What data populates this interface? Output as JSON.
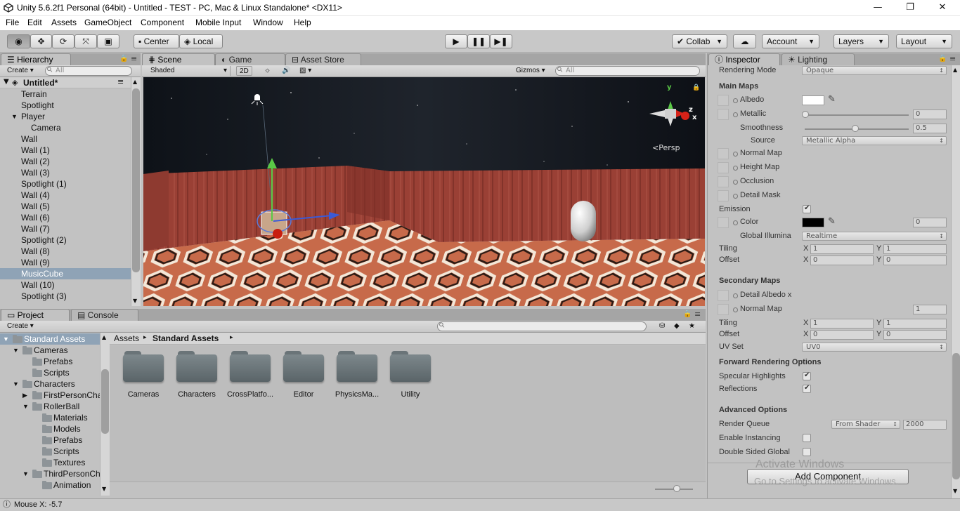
{
  "window": {
    "title": "Unity 5.6.2f1 Personal (64bit) - Untitled - TEST - PC, Mac & Linux Standalone* <DX11>",
    "minimize": "—",
    "restore": "❐",
    "close": "✕"
  },
  "menu": [
    "File",
    "Edit",
    "Assets",
    "GameObject",
    "Component",
    "Mobile Input",
    "Window",
    "Help"
  ],
  "toolbar": {
    "pivot": "Center",
    "space": "Local",
    "collab": "Collab",
    "account": "Account",
    "layers": "Layers",
    "layout": "Layout"
  },
  "hierarchy": {
    "tab": "Hierarchy",
    "create": "Create",
    "search_placeholder": "All",
    "scene_name": "Untitled*",
    "items": [
      {
        "label": "Terrain",
        "indent": 1
      },
      {
        "label": "Spotlight",
        "indent": 1
      },
      {
        "label": "Player",
        "indent": 1,
        "expanded": true
      },
      {
        "label": "Camera",
        "indent": 2
      },
      {
        "label": "Wall",
        "indent": 1
      },
      {
        "label": "Wall (1)",
        "indent": 1
      },
      {
        "label": "Wall (2)",
        "indent": 1
      },
      {
        "label": "Wall (3)",
        "indent": 1
      },
      {
        "label": "Spotlight (1)",
        "indent": 1
      },
      {
        "label": "Wall (4)",
        "indent": 1
      },
      {
        "label": "Wall (5)",
        "indent": 1
      },
      {
        "label": "Wall (6)",
        "indent": 1
      },
      {
        "label": "Wall (7)",
        "indent": 1
      },
      {
        "label": "Spotlight (2)",
        "indent": 1
      },
      {
        "label": "Wall (8)",
        "indent": 1
      },
      {
        "label": "Wall (9)",
        "indent": 1
      },
      {
        "label": "MusicCube",
        "indent": 1,
        "selected": true
      },
      {
        "label": "Wall (10)",
        "indent": 1
      },
      {
        "label": "Spotlight (3)",
        "indent": 1
      }
    ]
  },
  "scene": {
    "tabs": [
      "Scene",
      "Game",
      "Asset Store"
    ],
    "shading": "Shaded",
    "mode_2d": "2D",
    "gizmos": "Gizmos",
    "search_placeholder": "All",
    "persp": "Persp",
    "axis_x": "x",
    "axis_y": "y",
    "axis_z": "z"
  },
  "project": {
    "tabs": [
      "Project",
      "Console"
    ],
    "create": "Create",
    "breadcrumb_root": "Assets",
    "breadcrumb_current": "Standard Assets",
    "tree": [
      {
        "label": "Standard Assets",
        "indent": 0,
        "arrow": "▼",
        "selected": true
      },
      {
        "label": "Cameras",
        "indent": 1,
        "arrow": "▼"
      },
      {
        "label": "Prefabs",
        "indent": 2,
        "arrow": ""
      },
      {
        "label": "Scripts",
        "indent": 2,
        "arrow": ""
      },
      {
        "label": "Characters",
        "indent": 1,
        "arrow": "▼"
      },
      {
        "label": "FirstPersonCharacter",
        "indent": 2,
        "arrow": "▶"
      },
      {
        "label": "RollerBall",
        "indent": 2,
        "arrow": "▼"
      },
      {
        "label": "Materials",
        "indent": 3,
        "arrow": ""
      },
      {
        "label": "Models",
        "indent": 3,
        "arrow": ""
      },
      {
        "label": "Prefabs",
        "indent": 3,
        "arrow": ""
      },
      {
        "label": "Scripts",
        "indent": 3,
        "arrow": ""
      },
      {
        "label": "Textures",
        "indent": 3,
        "arrow": ""
      },
      {
        "label": "ThirdPersonCharacter",
        "indent": 2,
        "arrow": "▼"
      },
      {
        "label": "Animation",
        "indent": 3,
        "arrow": ""
      }
    ],
    "folders": [
      "Cameras",
      "Characters",
      "CrossPlatfo...",
      "Editor",
      "PhysicsMa...",
      "Utility"
    ]
  },
  "inspector": {
    "tabs": [
      "Inspector",
      "Lighting"
    ],
    "rendering_mode_label": "Rendering Mode",
    "rendering_mode_value": "Opaque",
    "main_maps": "Main Maps",
    "albedo": "Albedo",
    "metallic": "Metallic",
    "metallic_value": "0",
    "smoothness": "Smoothness",
    "smoothness_value": "0.5",
    "source": "Source",
    "source_value": "Metallic Alpha",
    "normal_map": "Normal Map",
    "height_map": "Height Map",
    "occlusion": "Occlusion",
    "detail_mask": "Detail Mask",
    "emission": "Emission",
    "color": "Color",
    "emission_value": "0",
    "global_illum": "Global Illumina",
    "global_illum_value": "Realtime",
    "tiling": "Tiling",
    "offset": "Offset",
    "x": "X",
    "y": "Y",
    "tiling_x": "1",
    "tiling_y": "1",
    "offset_x": "0",
    "offset_y": "0",
    "secondary_maps": "Secondary Maps",
    "detail_albedo": "Detail Albedo x",
    "normal_map2": "Normal Map",
    "normal_map2_value": "1",
    "tiling2_x": "1",
    "tiling2_y": "1",
    "offset2_x": "0",
    "offset2_y": "0",
    "uv_set": "UV Set",
    "uv_set_value": "UV0",
    "forward_options": "Forward Rendering Options",
    "specular_highlights": "Specular Highlights",
    "reflections": "Reflections",
    "advanced_options": "Advanced Options",
    "render_queue": "Render Queue",
    "render_queue_mode": "From Shader",
    "render_queue_value": "2000",
    "enable_instancing": "Enable Instancing",
    "double_sided": "Double Sided Global",
    "add_component": "Add Component",
    "watermark1": "Activate Windows",
    "watermark2": "Go to Settings to activate Windows."
  },
  "status": {
    "text": "Mouse X: -5.7"
  }
}
